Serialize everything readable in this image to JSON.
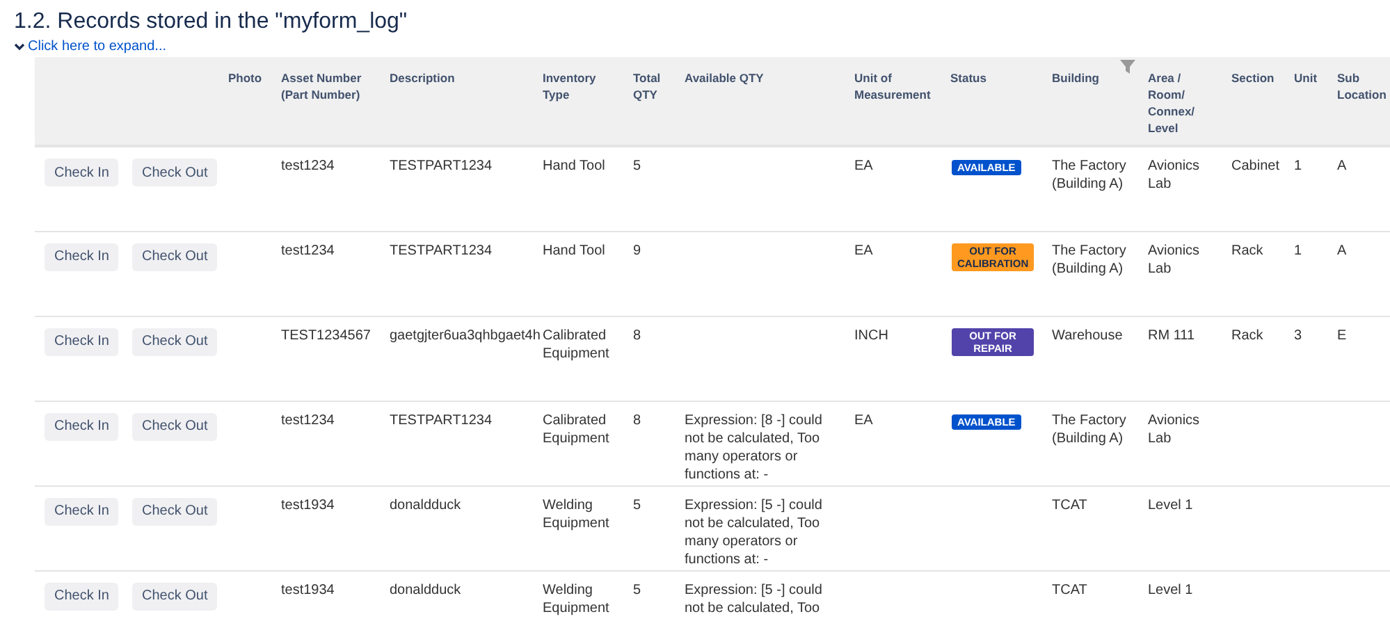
{
  "heading": "1.2. Records stored in the \"myform_log\"",
  "expand_link": "Click here to expand...",
  "table": {
    "columns": [
      "",
      "",
      "Photo",
      "Asset Number (Part Number)",
      "Description",
      "Inventory Type",
      "Total QTY",
      "Available QTY",
      "Unit of Measurement",
      "Status",
      "Building",
      "Area / Room/ Connex/ Level",
      "Section",
      "Unit",
      "Sub Location"
    ],
    "rows": [
      {
        "actions": [
          "Check In",
          "Check Out"
        ],
        "asset": "test1234",
        "description": "TESTPART1234",
        "type": "Hand Tool",
        "total": "5",
        "available": "",
        "uom": "EA",
        "status": {
          "text": "AVAILABLE",
          "kind": "available"
        },
        "building": "The Factory (Building A)",
        "area": "Avionics Lab",
        "section": "Cabinet",
        "unit": "1",
        "sub": "A"
      },
      {
        "actions": [
          "Check In",
          "Check Out"
        ],
        "asset": "test1234",
        "description": "TESTPART1234",
        "type": "Hand Tool",
        "total": "9",
        "available": "",
        "uom": "EA",
        "status": {
          "text": "OUT FOR CALIBRATION",
          "kind": "calibration"
        },
        "building": "The Factory (Building A)",
        "area": "Avionics Lab",
        "section": "Rack",
        "unit": "1",
        "sub": "A"
      },
      {
        "actions": [
          "Check In",
          "Check Out"
        ],
        "asset": "TEST1234567",
        "description": "gaetgjter6ua3qhbgaet4h",
        "type": "Calibrated Equipment",
        "total": "8",
        "available": "",
        "uom": "INCH",
        "status": {
          "text": "OUT FOR REPAIR",
          "kind": "repair"
        },
        "building": "Warehouse",
        "area": "RM 111",
        "section": "Rack",
        "unit": "3",
        "sub": "E"
      },
      {
        "actions": [
          "Check In",
          "Check Out"
        ],
        "asset": "test1234",
        "description": "TESTPART1234",
        "type": "Calibrated Equipment",
        "total": "8",
        "available": "Expression: [8 -] could not be calculated, Too many operators or functions at: -",
        "uom": "EA",
        "status": {
          "text": "AVAILABLE",
          "kind": "available"
        },
        "building": "The Factory (Building A)",
        "area": "Avionics Lab",
        "section": "",
        "unit": "",
        "sub": ""
      },
      {
        "actions": [
          "Check In",
          "Check Out"
        ],
        "asset": "test1934",
        "description": "donaldduck",
        "type": "Welding Equipment",
        "total": "5",
        "available": "Expression: [5 -] could not be calculated, Too many operators or functions at: -",
        "uom": "",
        "status": null,
        "building": "TCAT",
        "area": "Level 1",
        "section": "",
        "unit": "",
        "sub": ""
      },
      {
        "actions": [
          "Check In",
          "Check Out"
        ],
        "asset": "test1934",
        "description": "donaldduck",
        "type": "Welding Equipment",
        "total": "5",
        "available": "Expression: [5 -] could not be calculated, Too",
        "uom": "",
        "status": null,
        "building": "TCAT",
        "area": "Level 1",
        "section": "",
        "unit": "",
        "sub": ""
      }
    ]
  }
}
